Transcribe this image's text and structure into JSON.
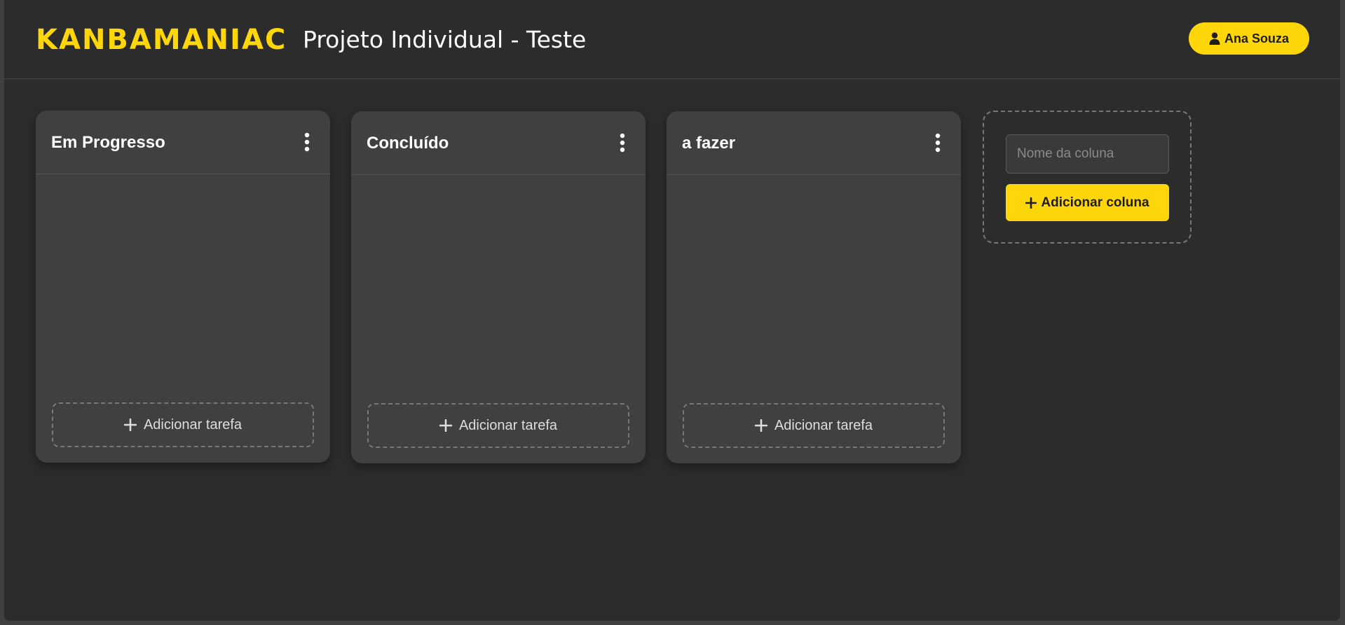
{
  "header": {
    "logo": "KANBAMANIAC",
    "project_title": "Projeto Individual - Teste",
    "user_name": "Ana Souza",
    "user_icon": "user-icon"
  },
  "columns": [
    {
      "title": "Em Progresso",
      "menu_icon": "kebab-menu-icon",
      "add_task_label": "Adicionar tarefa",
      "tasks": []
    },
    {
      "title": "Concluído",
      "menu_icon": "kebab-menu-icon",
      "add_task_label": "Adicionar tarefa",
      "tasks": []
    },
    {
      "title": "a fazer",
      "menu_icon": "kebab-menu-icon",
      "add_task_label": "Adicionar tarefa",
      "tasks": []
    }
  ],
  "add_column": {
    "placeholder": "Nome da coluna",
    "value": "",
    "button_label": "Adicionar coluna"
  },
  "colors": {
    "accent": "#ffd60a",
    "background": "#2c2c2c",
    "column_background": "#404040"
  }
}
